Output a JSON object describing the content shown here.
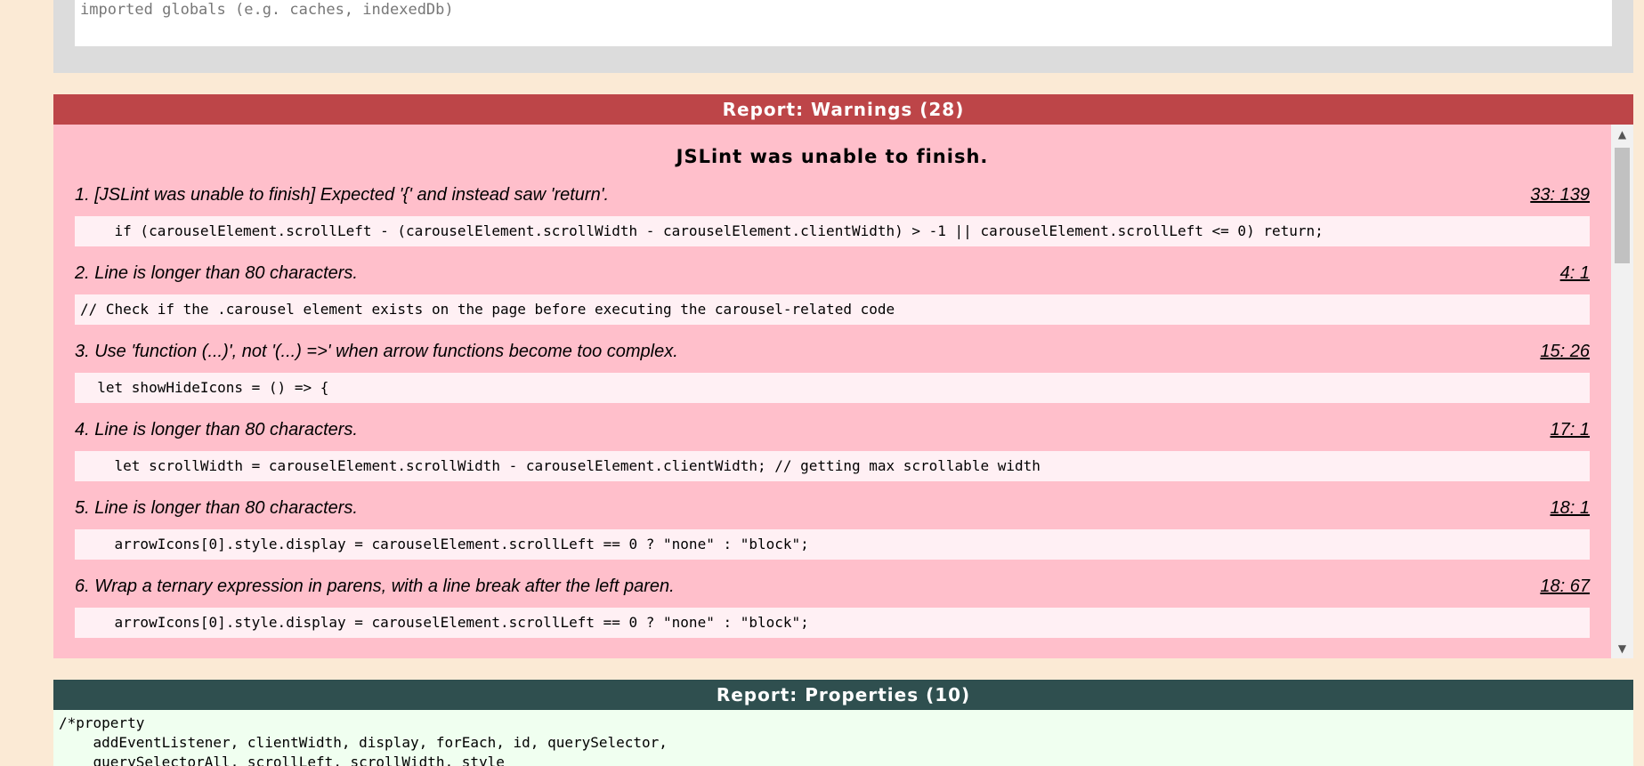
{
  "globals": {
    "text": "imported globals (e.g. caches, indexedDb)"
  },
  "warnings": {
    "header": "Report: Warnings (28)",
    "status": "JSLint was unable to finish.",
    "items": [
      {
        "message": "1. [JSLint was unable to finish] Expected '{' and instead saw 'return'.",
        "location": "33: 139",
        "code": "    if (carouselElement.scrollLeft - (carouselElement.scrollWidth - carouselElement.clientWidth) > -1 || carouselElement.scrollLeft <= 0) return;"
      },
      {
        "message": "2. Line is longer than 80 characters.",
        "location": "4: 1",
        "code": "// Check if the .carousel element exists on the page before executing the carousel-related code"
      },
      {
        "message": "3. Use 'function (...)', not '(...) =>' when arrow functions become too complex.",
        "location": "15: 26",
        "code": "  let showHideIcons = () => {"
      },
      {
        "message": "4. Line is longer than 80 characters.",
        "location": "17: 1",
        "code": "    let scrollWidth = carouselElement.scrollWidth - carouselElement.clientWidth; // getting max scrollable width"
      },
      {
        "message": "5. Line is longer than 80 characters.",
        "location": "18: 1",
        "code": "    arrowIcons[0].style.display = carouselElement.scrollLeft == 0 ? \"none\" : \"block\";"
      },
      {
        "message": "6. Wrap a ternary expression in parens, with a line break after the left paren.",
        "location": "18: 67",
        "code": "    arrowIcons[0].style.display = carouselElement.scrollLeft == 0 ? \"none\" : \"block\";"
      }
    ]
  },
  "properties": {
    "header": "Report: Properties (10)",
    "lines": [
      "/*property",
      "    addEventListener, clientWidth, display, forEach, id, querySelector,",
      "    querySelectorAll, scrollLeft, scrollWidth, style"
    ]
  },
  "colors": {
    "page_bg": "#fbead5",
    "warnings_header": "#bd4548",
    "warnings_body": "#ffbfcb",
    "properties_header": "#2f4f4f",
    "properties_body": "#f0fff0"
  }
}
